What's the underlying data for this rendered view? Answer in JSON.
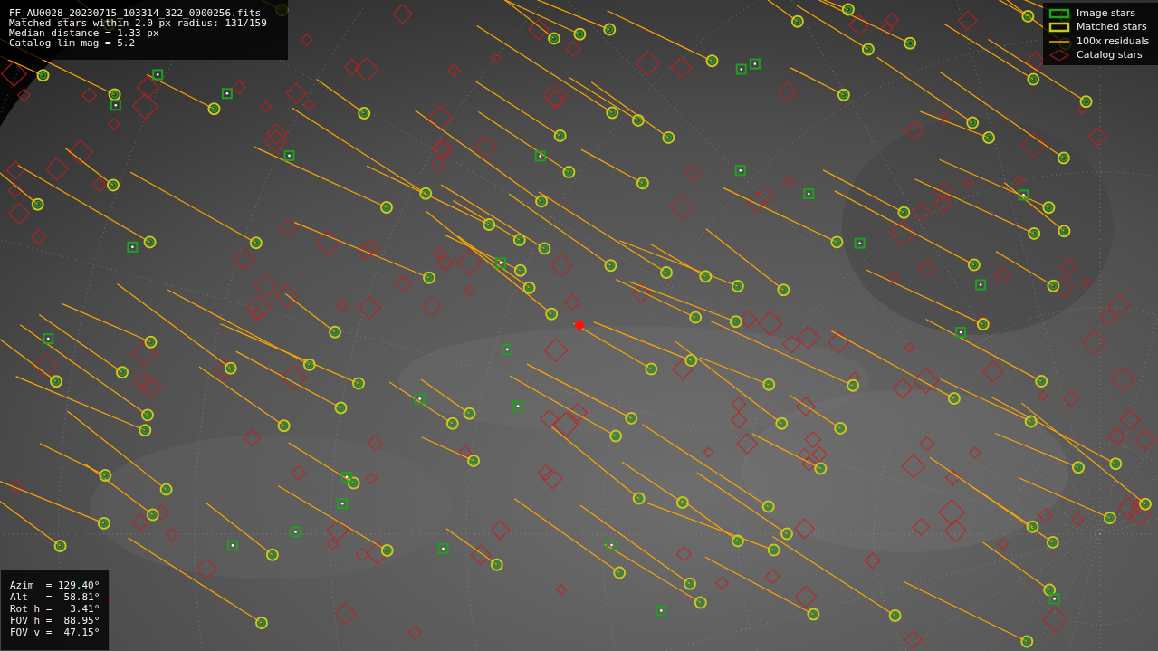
{
  "info": {
    "lines": [
      "FF_AU0028_20230715_103314_322_0000256.fits",
      "Matched stars within 2.0 px radius: 131/159",
      "Median distance = 1.33 px",
      "Catalog lim mag = 5.2"
    ]
  },
  "legend": {
    "items": [
      {
        "label": "Image stars"
      },
      {
        "label": "Matched stars",
        "kind": "matched"
      },
      {
        "label": "100x residuals",
        "kind": "residual"
      },
      {
        "label": "Catalog stars",
        "kind": "catalog"
      }
    ]
  },
  "pointing": {
    "lines": [
      "Azim  = 129.40°",
      "Alt   =  58.81°",
      "Rot h =   3.41°",
      "FOV h =  88.95°",
      "FOV v =  47.15°"
    ]
  }
}
